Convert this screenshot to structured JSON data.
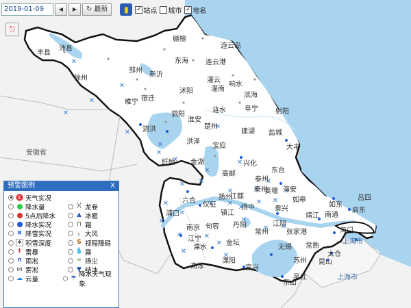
{
  "toolbar": {
    "date": "2019-01-09",
    "prev_icon": "◀",
    "next_icon": "▶",
    "refresh_icon": "↻",
    "refresh_label": "最新",
    "layer_icon": "bookmark-icon",
    "checks": [
      {
        "label": "站点",
        "checked": true
      },
      {
        "label": "城市",
        "checked": false
      },
      {
        "label": "地名",
        "checked": true
      }
    ]
  },
  "side_tool_icon": "export-icon",
  "legend": {
    "title": "预警图例",
    "close": "X",
    "items": [
      {
        "label": "天气实况",
        "symbol": "badge",
        "color": "#d92b2b",
        "selected": true
      },
      {
        "label": "降水量",
        "symbol": "dot",
        "color": "#2ec94a"
      },
      {
        "label": "龙卷",
        "symbol": "tornado",
        "color": "#444"
      },
      {
        "label": "5点后降水",
        "symbol": "dot",
        "color": "#d9342b"
      },
      {
        "label": "冰雹",
        "symbol": "triangle",
        "color": "#2a60c0"
      },
      {
        "label": "降水实况",
        "symbol": "dot",
        "color": "#1e5bd8"
      },
      {
        "label": "霜",
        "symbol": "frost",
        "color": "#444"
      },
      {
        "label": "降雪实况",
        "symbol": "snow",
        "color": "#2f7ad9"
      },
      {
        "label": "大风",
        "symbol": "wind",
        "color": "#333"
      },
      {
        "label": "积雪深度",
        "symbol": "snowdepth",
        "color": "#555"
      },
      {
        "label": "视程障碍",
        "symbol": "visibility",
        "color": "#b35a00"
      },
      {
        "label": "雷暴",
        "symbol": "thunder",
        "color": "#c22"
      },
      {
        "label": "露",
        "symbol": "dew",
        "color": "#2a7fd6"
      },
      {
        "label": "雨凇",
        "symbol": "glaze",
        "color": "#1a52b8"
      },
      {
        "label": "扬尘",
        "symbol": "dust",
        "color": "#4a8a3a"
      },
      {
        "label": "雾凇",
        "symbol": "rime",
        "color": "#555"
      },
      {
        "label": "结冰",
        "symbol": "ice",
        "color": "#1a52b8"
      },
      {
        "label": "云量",
        "symbol": "cloud",
        "color": "#2a7fd6"
      },
      {
        "label": "降水天气现象",
        "symbol": "rainphen",
        "color": "#1a52b8"
      }
    ]
  },
  "places": {
    "fengxian": "丰县",
    "peixian": "沛县",
    "xuzhou": "徐州",
    "pizhou": "邳州",
    "xinyi": "新沂",
    "suining": "睢宁",
    "ganyu": "赣榆",
    "lianyungang": "连云港",
    "donghai": "东海",
    "lianyundao": "连云岛",
    "guanyun": "灌云",
    "guannan": "灌南",
    "xiangshui": "响水",
    "binhai": "滨海",
    "funing": "阜宁",
    "sheyang": "射阳",
    "shuyang": "沭阳",
    "suqian": "宿迁",
    "siyang": "泗阳",
    "lianshui": "涟水",
    "huaian": "淮安",
    "sihong": "泗洪",
    "hongze": "洪泽",
    "jinhu": "金湖",
    "xuyi": "盱眙",
    "chuzhou": "楚州",
    "baoying": "宝应",
    "jianhu": "建湖",
    "yancheng": "盐城",
    "dafeng": "大丰",
    "xinghua": "兴化",
    "gaoyou": "高邮",
    "dongtai": "东台",
    "haian": "海安",
    "rudong": "如东",
    "rugao": "如皋",
    "taizhou": "泰州",
    "jiangdu": "江都",
    "yangzhou": "扬州",
    "yizheng": "仪征",
    "liuhe": "六合",
    "pukou": "浦口",
    "nanjing": "南京",
    "jiangning": "江宁",
    "lishui": "溧水",
    "gaochun": "高淳",
    "jurong": "句容",
    "zhenjiang": "镇江",
    "yangzhong": "扬中",
    "danyang": "丹阳",
    "jintan": "金坛",
    "liyang": "溧阳",
    "changzhou": "常州",
    "jiangyin": "江阴",
    "wuxi": "无锡",
    "yixing": "宜兴",
    "zhangjiagang": "张家港",
    "changshu": "常熟",
    "taicang": "太仓",
    "kunshan": "昆山",
    "suzhou": "苏州",
    "wujiang": "吴江",
    "dongshan": "东山",
    "nantong": "南通",
    "haimen": "海门",
    "qidong": "启东",
    "lusi": "吕四",
    "jingjiang": "靖江",
    "taixing": "泰兴",
    "jiangyan": "姜堰",
    "taizhou2": "泰州",
    "anhui": "安徽省",
    "shanghai": "上海市",
    "shanghai2": "上海市"
  }
}
